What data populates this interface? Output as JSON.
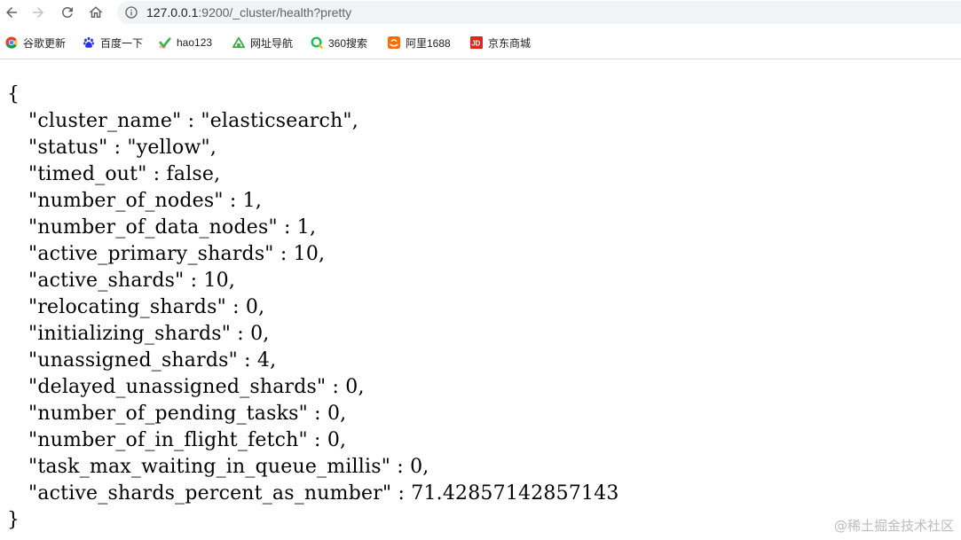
{
  "address_bar": {
    "url_host": "127.0.0.1",
    "url_rest": ":9200/_cluster/health?pretty"
  },
  "bookmarks": [
    {
      "label": "谷歌更新",
      "icon": "chrome-icon"
    },
    {
      "label": "百度一下",
      "icon": "baidu-paw-icon"
    },
    {
      "label": "hao123",
      "icon": "hao123-icon"
    },
    {
      "label": "网址导航",
      "icon": "url-nav-icon"
    },
    {
      "label": "360搜索",
      "icon": "360-search-icon"
    },
    {
      "label": "阿里1688",
      "icon": "alibaba-1688-icon"
    },
    {
      "label": "京东商城",
      "icon": "jd-icon"
    }
  ],
  "json_body": {
    "open_brace": "{",
    "close_brace": "}",
    "lines": [
      "\"cluster_name\" : \"elasticsearch\",",
      "\"status\" : \"yellow\",",
      "\"timed_out\" : false,",
      "\"number_of_nodes\" : 1,",
      "\"number_of_data_nodes\" : 1,",
      "\"active_primary_shards\" : 10,",
      "\"active_shards\" : 10,",
      "\"relocating_shards\" : 0,",
      "\"initializing_shards\" : 0,",
      "\"unassigned_shards\" : 4,",
      "\"delayed_unassigned_shards\" : 0,",
      "\"number_of_pending_tasks\" : 0,",
      "\"number_of_in_flight_fetch\" : 0,",
      "\"task_max_waiting_in_queue_millis\" : 0,",
      "\"active_shards_percent_as_number\" : 71.42857142857143"
    ]
  },
  "watermark": "@稀土掘金技术社区"
}
